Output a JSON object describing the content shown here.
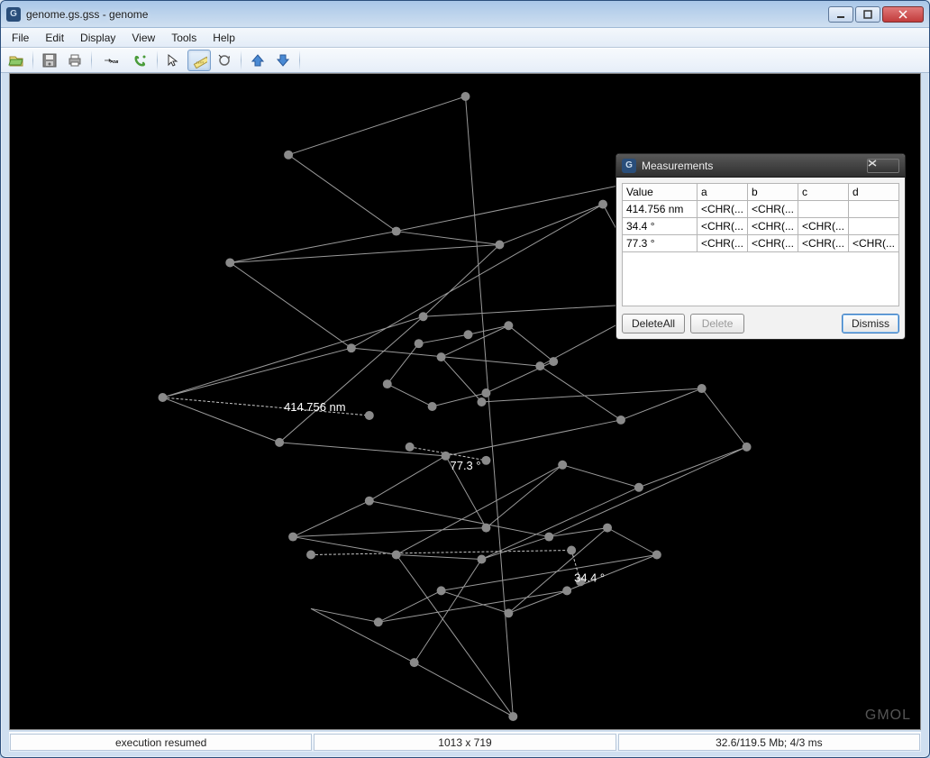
{
  "window": {
    "title": "genome.gs.gss - genome"
  },
  "menubar": {
    "file": "File",
    "edit": "Edit",
    "display": "Display",
    "view": "View",
    "tools": "Tools",
    "help": "Help"
  },
  "toolbar": {
    "open": "open-icon",
    "save": "save-icon",
    "print": "print-icon",
    "pdb": "PDB",
    "link": "link-icon",
    "select": "select-icon",
    "measure": "measure-icon",
    "rotate": "rotate-icon",
    "up": "up-icon",
    "down": "down-icon"
  },
  "canvas": {
    "labels": {
      "distance": "414.756 nm",
      "angle1": "77.3 °",
      "angle2": "34.4 °"
    },
    "watermark": "GMOL"
  },
  "popup": {
    "title": "Measurements",
    "columns": {
      "value": "Value",
      "a": "a",
      "b": "b",
      "c": "c",
      "d": "d"
    },
    "rows": [
      {
        "value": "414.756 nm",
        "a": "<CHR(...",
        "b": "<CHR(...",
        "c": "",
        "d": ""
      },
      {
        "value": "34.4 °",
        "a": "<CHR(...",
        "b": "<CHR(...",
        "c": "<CHR(...",
        "d": ""
      },
      {
        "value": "77.3 °",
        "a": "<CHR(...",
        "b": "<CHR(...",
        "c": "<CHR(...",
        "d": "<CHR(..."
      }
    ],
    "buttons": {
      "delete_all": "DeleteAll",
      "delete": "Delete",
      "dismiss": "Dismiss"
    }
  },
  "statusbar": {
    "left": "execution resumed",
    "center": "1013 x 719",
    "right": "32.6/119.5 Mb;   4/3 ms"
  }
}
